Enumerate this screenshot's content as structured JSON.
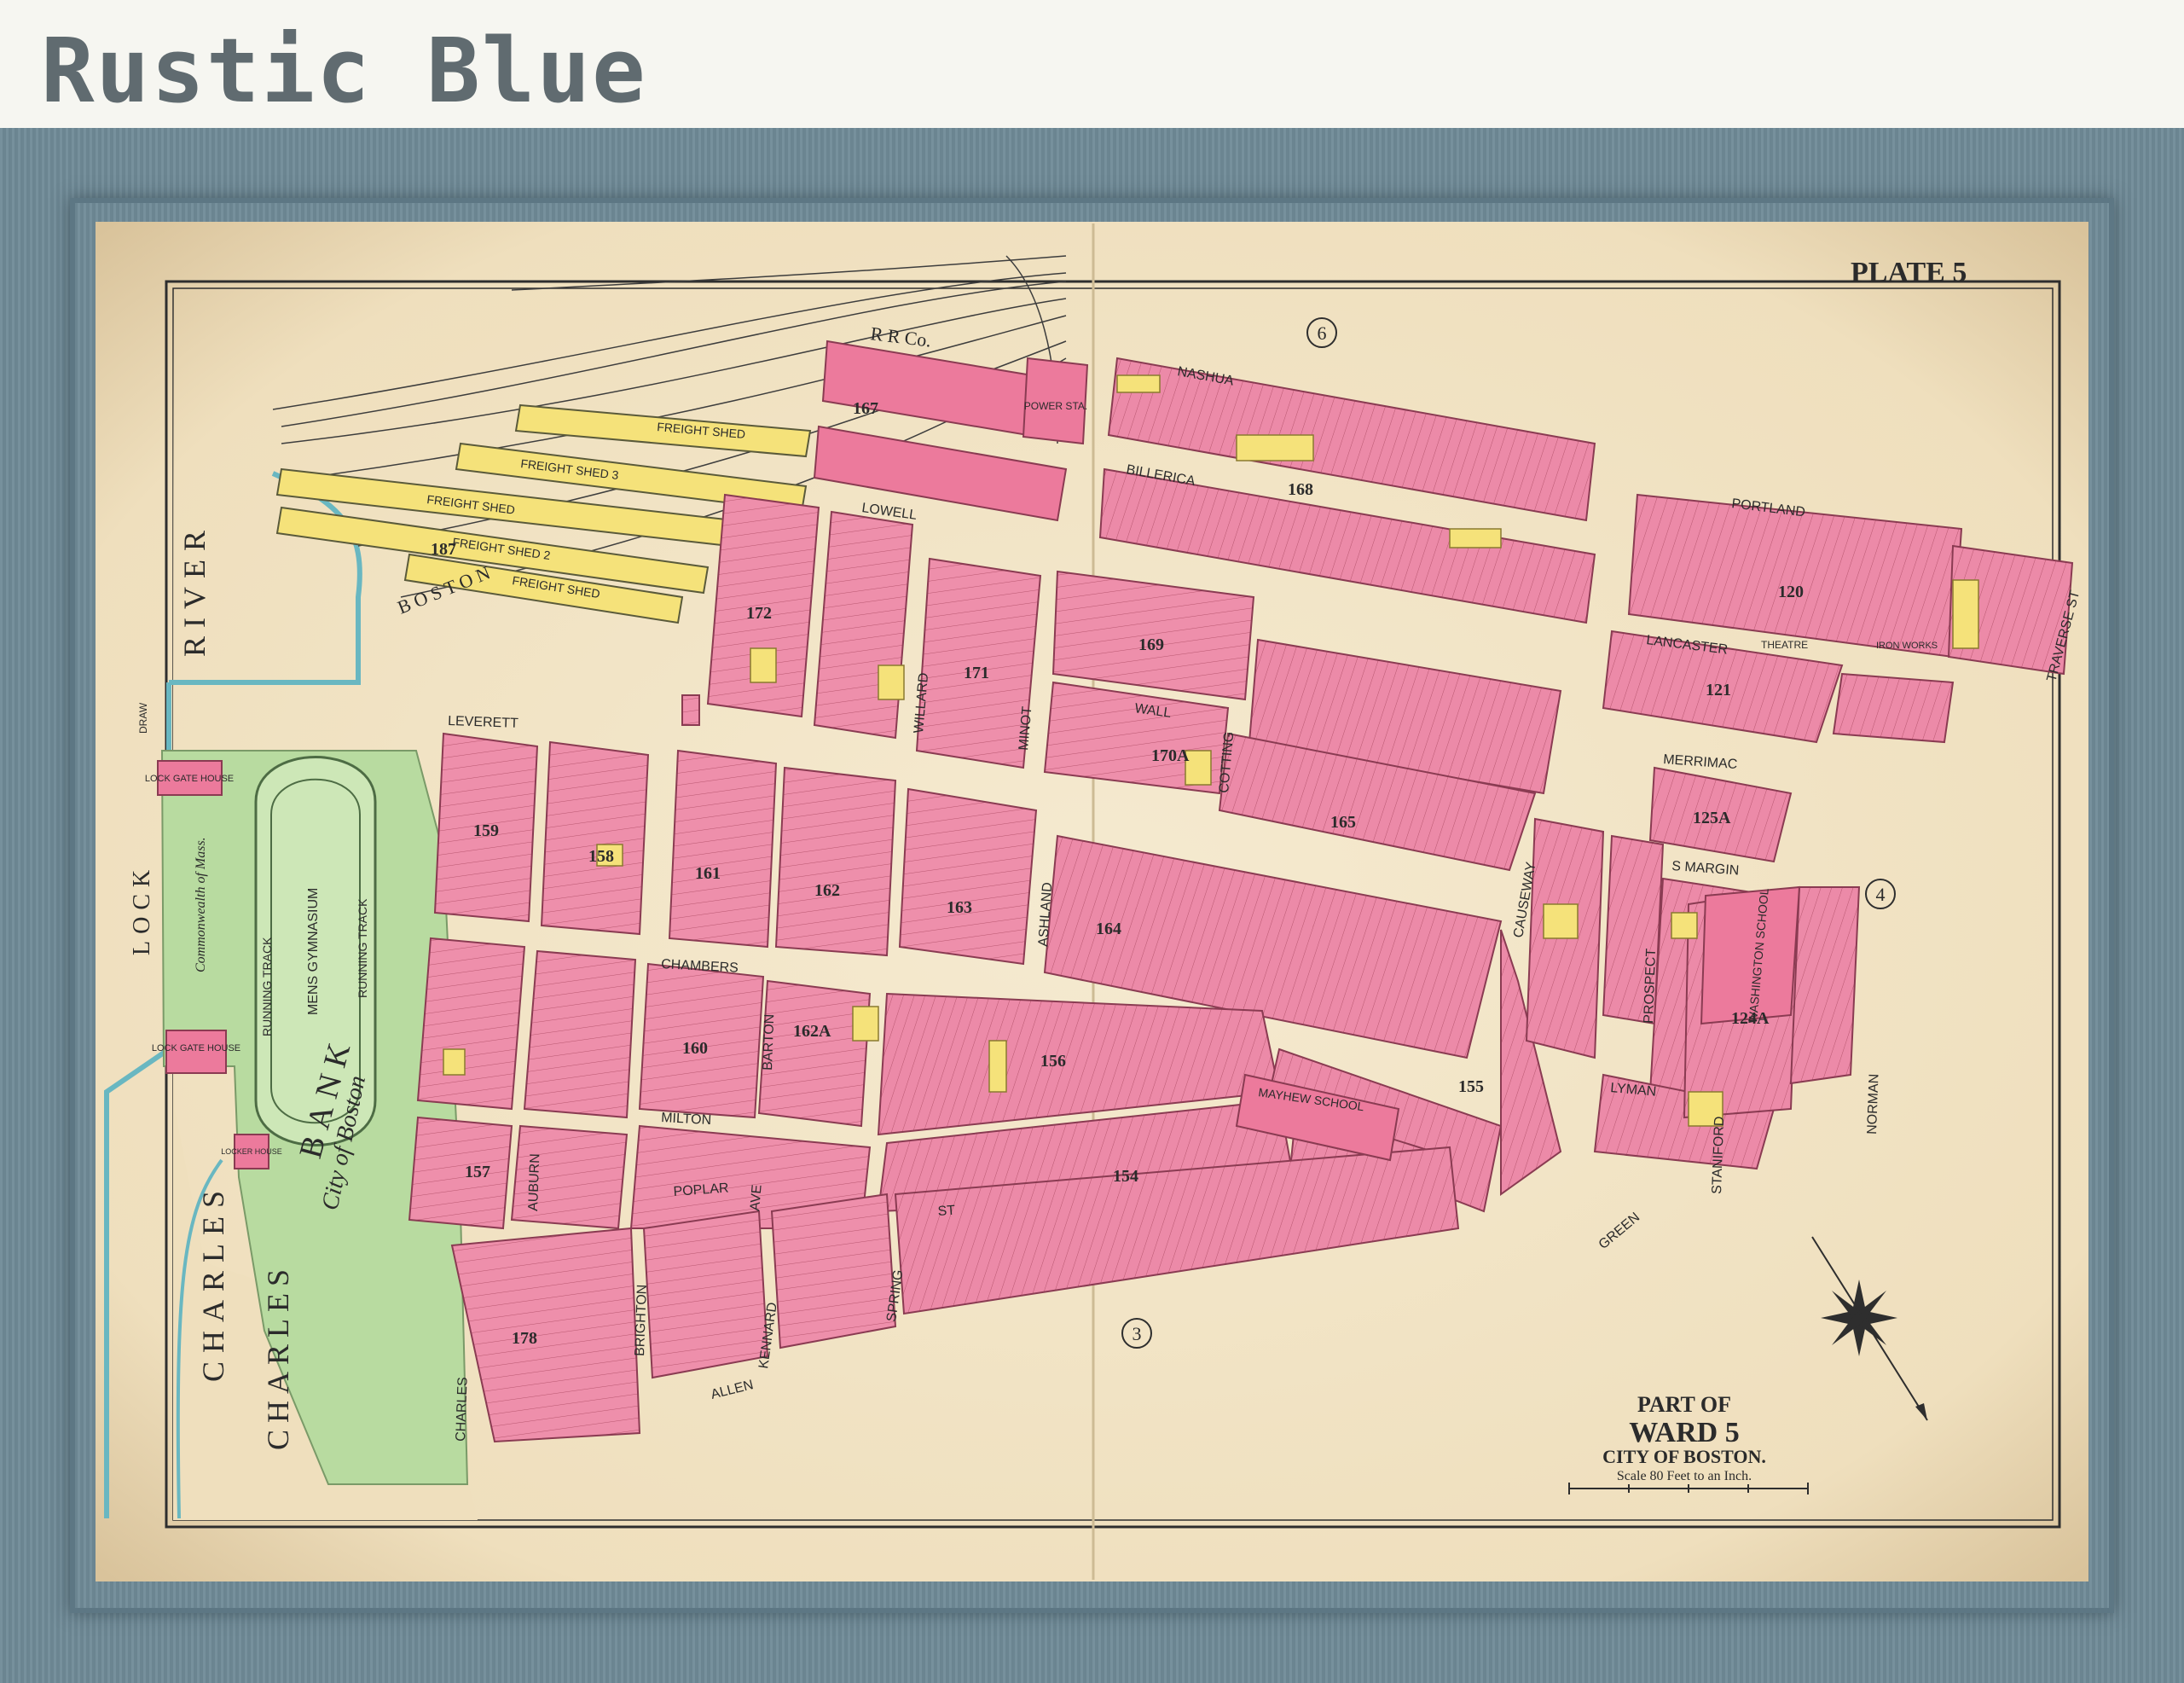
{
  "banner": {
    "title": "Rustic Blue"
  },
  "map": {
    "plate": "PLATE 5",
    "ward_prefix": "PART OF",
    "ward": "WARD 5",
    "city": "CITY OF BOSTON.",
    "scale": "Scale 80 Feet to an Inch.",
    "ward_numbers": [
      "6",
      "4",
      "3"
    ],
    "blocks": [
      "172",
      "167",
      "168",
      "169",
      "171",
      "165",
      "164",
      "163",
      "162",
      "161",
      "160",
      "159",
      "158",
      "157",
      "156",
      "155",
      "154",
      "170A",
      "162A",
      "124A",
      "125A",
      "120",
      "121",
      "178",
      "187"
    ],
    "water": {
      "river_1": "RIVER",
      "river_2": "CHARLES",
      "lock": "LOCK",
      "draw": "DRAW"
    },
    "bank": {
      "name_1": "CHARLES",
      "name_2": "BANK",
      "city_of_boston": "City of Boston"
    },
    "railroad": {
      "rr": "R  R  Co.",
      "initials": "B  O  S  T  O  N",
      "power": "POWER STA.",
      "sheds": [
        "FREIGHT  SHED",
        "FREIGHT  SHED  3",
        "FREIGHT  SHED",
        "FREIGHT  SHED  2",
        "FREIGHT  SHED"
      ]
    },
    "buildings": {
      "lock_gate_house": "LOCK GATE HOUSE",
      "locker_house": "LOCKER HOUSE",
      "gymnasium": "MENS GYMNASIUM",
      "running_track": "RUNNING TRACK",
      "theatre": "THEATRE",
      "mayhew_school": "MAYHEW SCHOOL",
      "washington_school": "WASHINGTON SCHOOL",
      "iron_works": "IRON WORKS",
      "commonwealth": "Commonwealth of Mass."
    },
    "streets": {
      "nashua": "NASHUA",
      "billerica": "BILLERICA",
      "portland": "PORTLAND",
      "lancaster": "LANCASTER",
      "traverse": "TRAVERSE ST",
      "merrimac": "MERRIMAC",
      "margin": "S MARGIN",
      "lowell": "LOWELL",
      "leverett": "LEVERETT",
      "wall": "WALL",
      "minot": "MINOT",
      "willard": "WILLARD",
      "cotting": "COTTING",
      "causeway": "CAUSEWAY",
      "chambers": "CHAMBERS",
      "barton": "BARTON",
      "milton": "MILTON",
      "poplar": "POPLAR",
      "allen": "ALLEN",
      "charles": "CHARLES",
      "brighton": "BRIGHTON",
      "auburn": "AUBURN",
      "kennard": "KENNARD",
      "spring": "SPRING",
      "ashland": "ASHLAND",
      "green": "GREEN",
      "lyman": "LYMAN",
      "prospect": "PROSPECT",
      "staniford": "STANIFORD",
      "norman": "NORMAN",
      "st": "ST",
      "ave": "AVE"
    }
  }
}
